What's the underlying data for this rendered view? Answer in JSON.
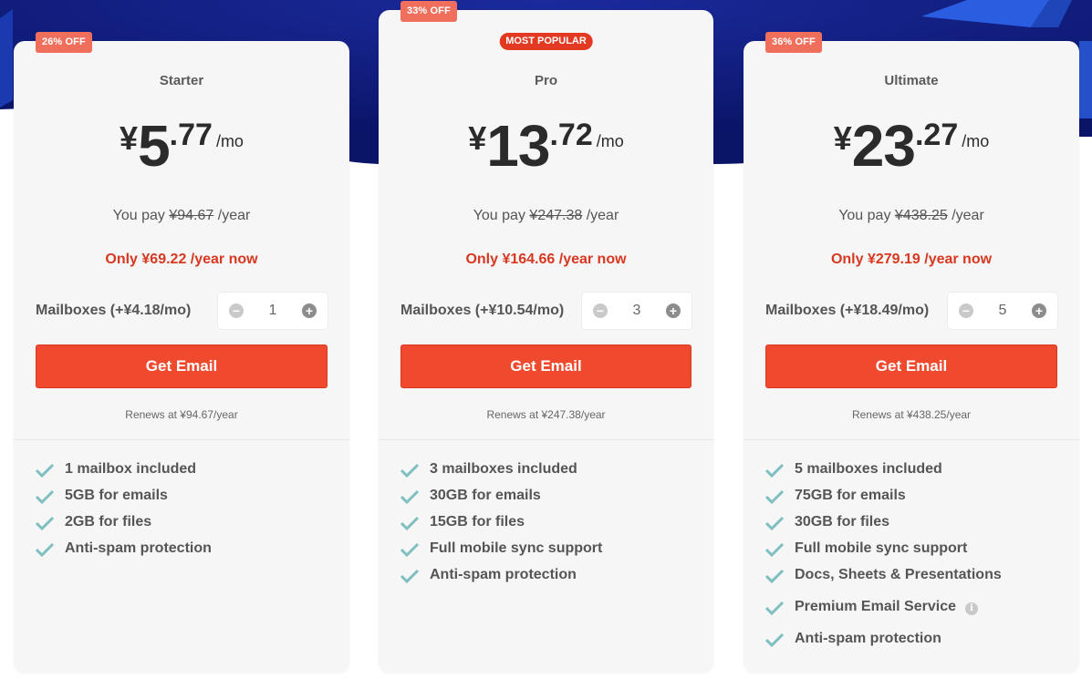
{
  "plans": [
    {
      "discount": "26% OFF",
      "popular": "",
      "name": "Starter",
      "currency": "¥",
      "price_int": "5",
      "price_dec": ".77",
      "per": "/mo",
      "you_pay_prefix": "You pay",
      "you_pay_original": "¥94.67",
      "you_pay_suffix": "/year",
      "only_now": "Only ¥69.22 /year now",
      "mailbox_label": "Mailboxes (+¥4.18/mo)",
      "mailbox_count": "1",
      "button": "Get Email",
      "renews": "Renews at ¥94.67/year",
      "features": [
        "1 mailbox included",
        "5GB for emails",
        "2GB for files",
        "Anti-spam protection"
      ]
    },
    {
      "discount": "33% OFF",
      "popular": "MOST POPULAR",
      "name": "Pro",
      "currency": "¥",
      "price_int": "13",
      "price_dec": ".72",
      "per": "/mo",
      "you_pay_prefix": "You pay",
      "you_pay_original": "¥247.38",
      "you_pay_suffix": "/year",
      "only_now": "Only ¥164.66 /year now",
      "mailbox_label": "Mailboxes (+¥10.54/mo)",
      "mailbox_count": "3",
      "button": "Get Email",
      "renews": "Renews at ¥247.38/year",
      "features": [
        "3 mailboxes included",
        "30GB for emails",
        "15GB for files",
        "Full mobile sync support",
        "Anti-spam protection"
      ]
    },
    {
      "discount": "36% OFF",
      "popular": "",
      "name": "Ultimate",
      "currency": "¥",
      "price_int": "23",
      "price_dec": ".27",
      "per": "/mo",
      "you_pay_prefix": "You pay",
      "you_pay_original": "¥438.25",
      "you_pay_suffix": "/year",
      "only_now": "Only ¥279.19 /year now",
      "mailbox_label": "Mailboxes (+¥18.49/mo)",
      "mailbox_count": "5",
      "button": "Get Email",
      "renews": "Renews at ¥438.25/year",
      "features": [
        "5 mailboxes included",
        "75GB for emails",
        "30GB for files",
        "Full mobile sync support",
        "Docs, Sheets & Presentations",
        "Premium Email Service",
        "Anti-spam protection"
      ]
    }
  ],
  "icons": {
    "minus": "−",
    "plus": "+",
    "info": "i",
    "check": "check-icon"
  },
  "colors": {
    "accent": "#f04a2e",
    "badge": "#f06f5c",
    "popular_badge": "#e23a22",
    "check": "#7fbfbf",
    "hero_bg": "#0d1a78"
  }
}
